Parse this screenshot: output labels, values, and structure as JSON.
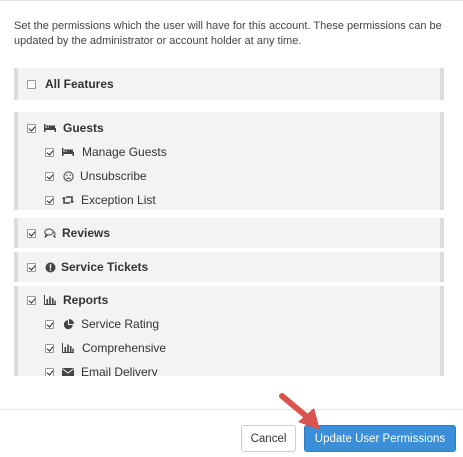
{
  "description": "Set the permissions which the user will have for this account. These permissions can be updated by the administrator or account holder at any time.",
  "permissions": {
    "all_features": {
      "label": "All Features",
      "checked": false
    },
    "guests": {
      "label": "Guests",
      "checked": true,
      "icon": "bed-icon",
      "children": [
        {
          "label": "Manage Guests",
          "checked": true,
          "icon": "bed-icon"
        },
        {
          "label": "Unsubscribe",
          "checked": true,
          "icon": "frown-icon"
        },
        {
          "label": "Exception List",
          "checked": true,
          "icon": "retweet-icon"
        }
      ]
    },
    "reviews": {
      "label": "Reviews",
      "checked": true,
      "icon": "comments-icon"
    },
    "service_tickets": {
      "label": "Service Tickets",
      "checked": true,
      "icon": "exclamation-circle-icon"
    },
    "reports": {
      "label": "Reports",
      "checked": true,
      "icon": "bar-chart-icon",
      "children": [
        {
          "label": "Service Rating",
          "checked": true,
          "icon": "pie-chart-icon"
        },
        {
          "label": "Comprehensive",
          "checked": true,
          "icon": "bar-chart-icon"
        },
        {
          "label": "Email Delivery",
          "checked": true,
          "icon": "envelope-icon"
        }
      ]
    }
  },
  "footer": {
    "cancel_label": "Cancel",
    "update_label": "Update User Permissions"
  },
  "colors": {
    "primary": "#3a8fd8",
    "annotation_arrow": "#d9534f"
  }
}
